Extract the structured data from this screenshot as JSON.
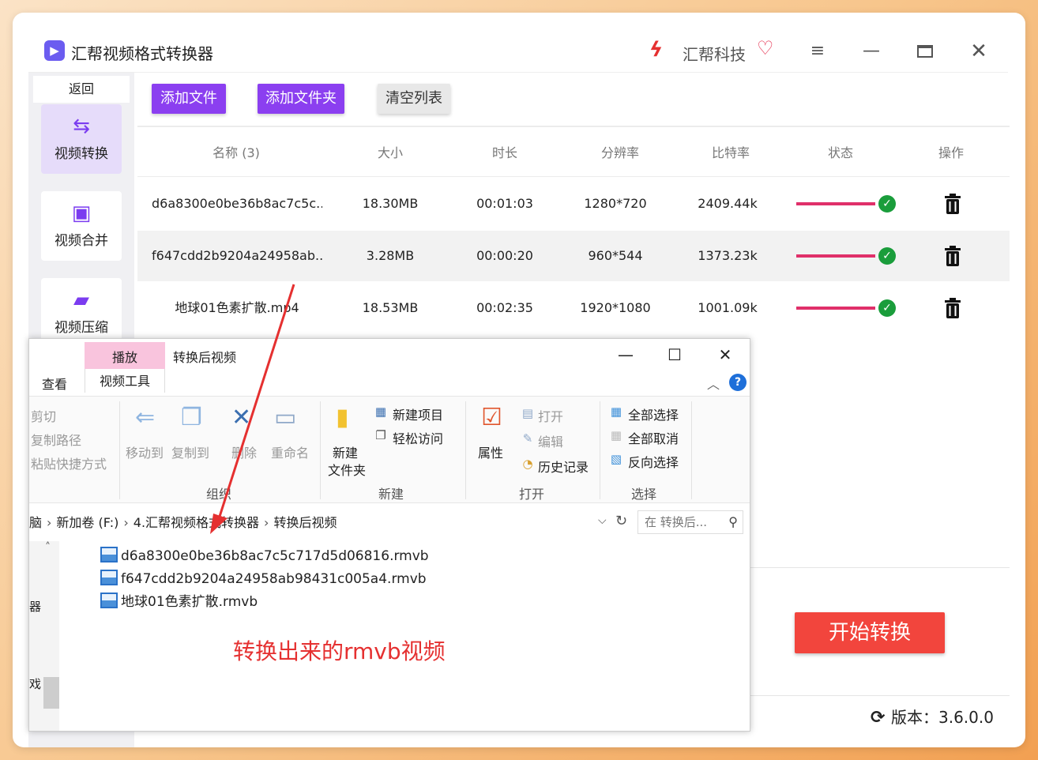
{
  "app": {
    "title": "汇帮视频格式转换器",
    "brand": "汇帮科技",
    "logo_icon": "video-app-icon",
    "window_controls": [
      "menu-icon",
      "minimize-icon",
      "maximize-icon",
      "close-icon"
    ]
  },
  "sidebar": {
    "back_label": "返回",
    "items": [
      {
        "label": "视频转换",
        "icon": "video-convert-icon",
        "active": true
      },
      {
        "label": "视频合并",
        "icon": "video-merge-icon",
        "active": false
      },
      {
        "label": "视频压缩",
        "icon": "video-compress-icon",
        "active": false
      }
    ]
  },
  "toolbar": {
    "add_file": "添加文件",
    "add_folder": "添加文件夹",
    "clear_list": "清空列表"
  },
  "table": {
    "headers": [
      "名称 (3)",
      "大小",
      "时长",
      "分辨率",
      "比特率",
      "状态",
      "操作"
    ],
    "rows": [
      {
        "name": "d6a8300e0be36b8ac7c5c...",
        "size": "18.30MB",
        "duration": "00:01:03",
        "resolution": "1280*720",
        "bitrate": "2409.44k",
        "progress": 1.0
      },
      {
        "name": "f647cdd2b9204a24958ab...",
        "size": "3.28MB",
        "duration": "00:00:20",
        "resolution": "960*544",
        "bitrate": "1373.23k",
        "progress": 1.0
      },
      {
        "name": "地球01色素扩散.mp4",
        "size": "18.53MB",
        "duration": "00:02:35",
        "resolution": "1920*1080",
        "bitrate": "1001.09k",
        "progress": 1.0
      }
    ]
  },
  "footer": {
    "start_button": "开始转换",
    "version": "版本：3.6.0.0"
  },
  "explorer": {
    "play_tab": "播放",
    "title": "转换后视频",
    "tab_view": "查看",
    "tab_video_tools": "视频工具",
    "ribbon": {
      "clipboard": [
        "剪切",
        "复制路径",
        "粘贴快捷方式"
      ],
      "move_to": "移动到",
      "copy_to": "复制到",
      "delete": "删除",
      "rename": "重命名",
      "group_organize": "组织",
      "new_folder": "新建\n文件夹",
      "new_folder_line1": "新建",
      "new_folder_line2": "文件夹",
      "new_item": "新建项目",
      "easy_access": "轻松访问",
      "group_new": "新建",
      "properties": "属性",
      "open": "打开",
      "edit": "编辑",
      "history": "历史记录",
      "group_open": "打开",
      "select_all": "全部选择",
      "select_none": "全部取消",
      "invert_selection": "反向选择",
      "group_select": "选择"
    },
    "address": {
      "segments": [
        "脑",
        "新加卷 (F:)",
        "4.汇帮视频格式转换器",
        "转换后视频"
      ]
    },
    "search_placeholder": "在 转换后...",
    "nav_cut_items": [
      "器",
      "戏"
    ],
    "files": [
      "d6a8300e0be36b8ac7c5c717d5d06816.rmvb",
      "f647cdd2b9204a24958ab98431c005a4.rmvb",
      "地球01色素扩散.rmvb"
    ]
  },
  "annotation": "转换出来的rmvb视频",
  "colors": {
    "accent_purple": "#8b3ff0",
    "progress_pink": "#e0306a",
    "success_green": "#1a9d3b",
    "start_red": "#f2453d",
    "annotation_red": "#e53030"
  }
}
